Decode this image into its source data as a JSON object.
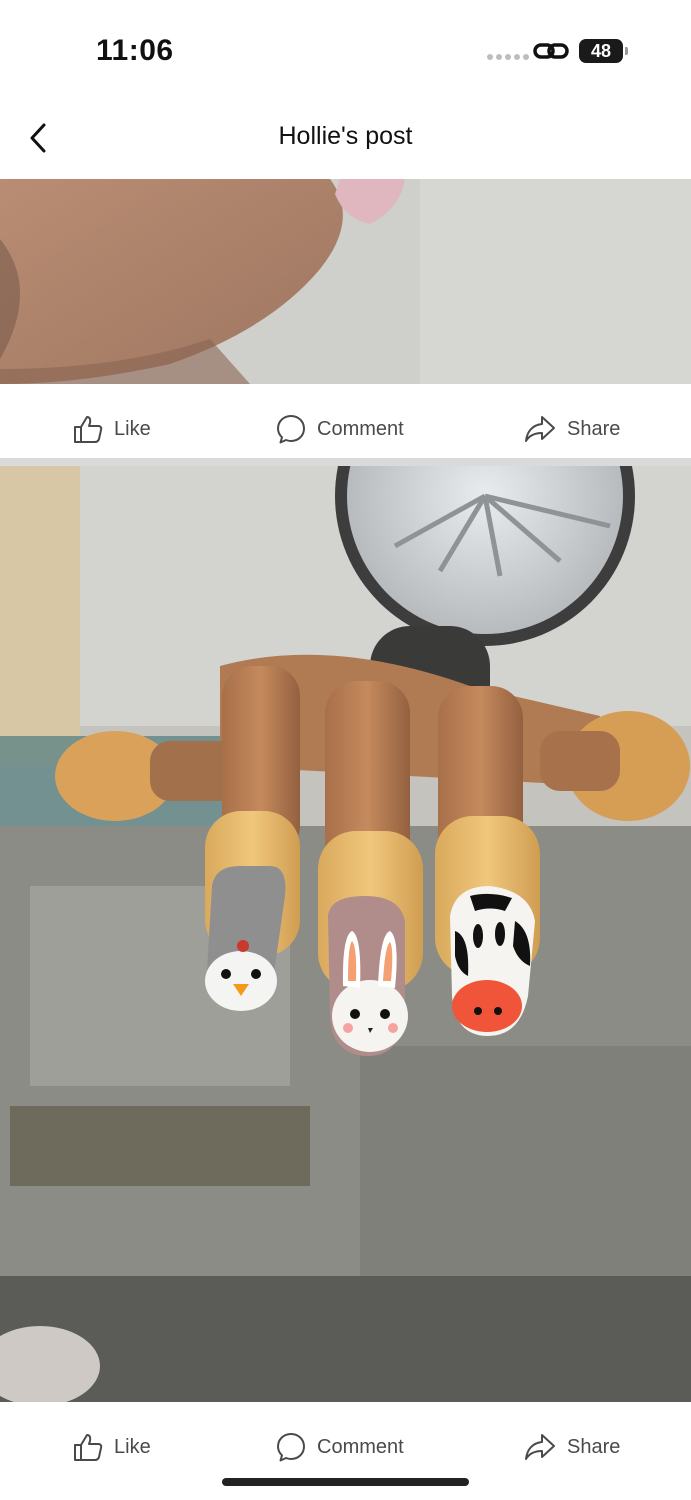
{
  "status_bar": {
    "time": "11:06",
    "battery": "48",
    "icons": [
      "signal-dots-icon",
      "link-icon",
      "battery-icon"
    ]
  },
  "header": {
    "title": "Hollie's post",
    "back_icon": "chevron-left-icon"
  },
  "photos": [
    {
      "name": "hand-holding-nail-photo"
    },
    {
      "name": "painted-fake-nails-photo"
    }
  ],
  "actions": {
    "like": "Like",
    "comment": "Comment",
    "share": "Share",
    "icons": {
      "like": "thumbs-up-icon",
      "comment": "comment-bubble-icon",
      "share": "share-arrow-icon"
    }
  },
  "colors": {
    "background": "#ffffff",
    "separator": "#d9dadc",
    "text": "#111111",
    "action_text": "#4a4a4a"
  }
}
